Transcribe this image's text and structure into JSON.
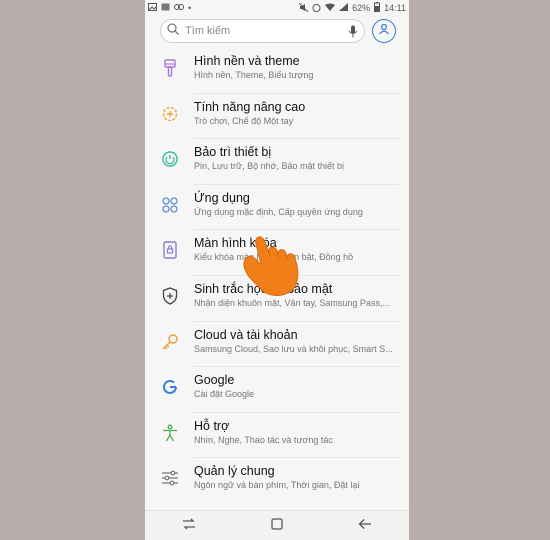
{
  "status_bar": {
    "battery": "62%",
    "time": "14:11"
  },
  "search": {
    "placeholder": "Tìm kiếm"
  },
  "settings": [
    {
      "title": "Hình nền và theme",
      "subtitle": "Hình nền, Theme, Biểu tượng",
      "icon": "brush-icon"
    },
    {
      "title": "Tính năng nâng cao",
      "subtitle": "Trò chơi, Chế độ Một tay",
      "icon": "gear-plus-icon"
    },
    {
      "title": "Bảo trì thiết bị",
      "subtitle": "Pin, Lưu trữ, Bộ nhớ, Bảo mật thiết bị",
      "icon": "device-care-icon"
    },
    {
      "title": "Ứng dụng",
      "subtitle": "Ứng dụng mặc định, Cấp quyền ứng dụng",
      "icon": "apps-grid-icon"
    },
    {
      "title": "Màn hình khóa",
      "subtitle": "Kiểu khóa màn hình, Luôn bật, Đồng hồ",
      "icon": "lock-screen-icon"
    },
    {
      "title": "Sinh trắc học và bảo mật",
      "subtitle": "Nhận diện khuôn mặt, Vân tay, Samsung Pass,...",
      "icon": "shield-icon"
    },
    {
      "title": "Cloud và tài khoản",
      "subtitle": "Samsung Cloud, Sao lưu và khôi phục, Smart S...",
      "icon": "key-icon"
    },
    {
      "title": "Google",
      "subtitle": "Cài đặt Google",
      "icon": "google-icon"
    },
    {
      "title": "Hỗ trợ",
      "subtitle": "Nhìn, Nghe, Thao tác và tương tác",
      "icon": "accessibility-icon"
    },
    {
      "title": "Quản lý chung",
      "subtitle": "Ngôn ngữ và bàn phím, Thời gian, Đặt lại",
      "icon": "sliders-icon"
    }
  ],
  "colors": {
    "background": "#b7adab",
    "accent": "#3a7bd5",
    "hand": "#f07f1a"
  }
}
